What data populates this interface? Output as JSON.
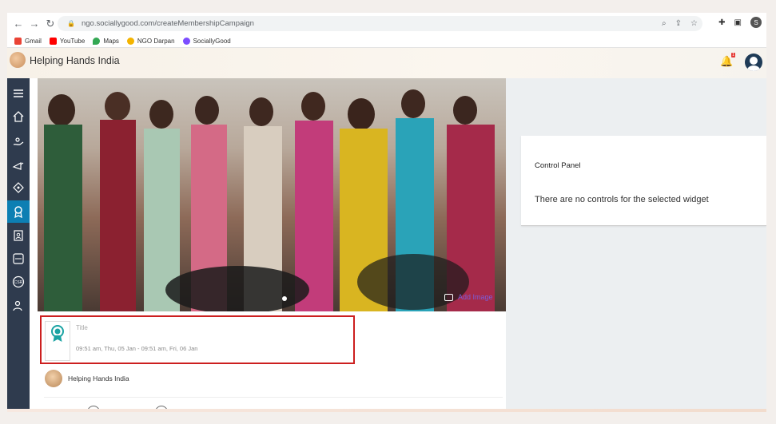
{
  "browser": {
    "url": "ngo.sociallygood.com/createMembershipCampaign",
    "profile_initial": "S",
    "bookmarks": [
      {
        "label": "Gmail",
        "color": "#ea4335"
      },
      {
        "label": "YouTube",
        "color": "#ff0000"
      },
      {
        "label": "Maps",
        "color": "#34a853"
      },
      {
        "label": "NGO Darpan",
        "color": "#f4b400"
      },
      {
        "label": "SociallyGood",
        "color": "#7c4dff"
      }
    ]
  },
  "header": {
    "org_name": "Helping Hands India",
    "notification_count": "1"
  },
  "sidebar": {
    "items": [
      {
        "icon": "menu-icon"
      },
      {
        "icon": "home-icon"
      },
      {
        "icon": "donate-hand-icon"
      },
      {
        "icon": "campaign-icon"
      },
      {
        "icon": "tag-icon"
      },
      {
        "icon": "membership-badge-icon",
        "active": true
      },
      {
        "icon": "contacts-icon"
      },
      {
        "icon": "ngo-icon"
      },
      {
        "icon": "csr-icon",
        "label": "CSR"
      },
      {
        "icon": "volunteers-icon"
      }
    ]
  },
  "hero": {
    "add_image_label": "Add Image"
  },
  "control_panel": {
    "title": "Control Panel",
    "message": "There are no controls for the selected widget"
  },
  "card": {
    "title_placeholder": "Title",
    "date_range": "09:51 am, Thu, 05 Jan - 09:51 am, Fri, 06 Jan"
  },
  "org_row": {
    "name": "Helping Hands India"
  },
  "colors": {
    "sidebar_bg": "#2f3b4e",
    "sidebar_active": "#0d7fb3",
    "card_border": "#cc1f1f",
    "accent_teal": "#1aa3a3"
  }
}
